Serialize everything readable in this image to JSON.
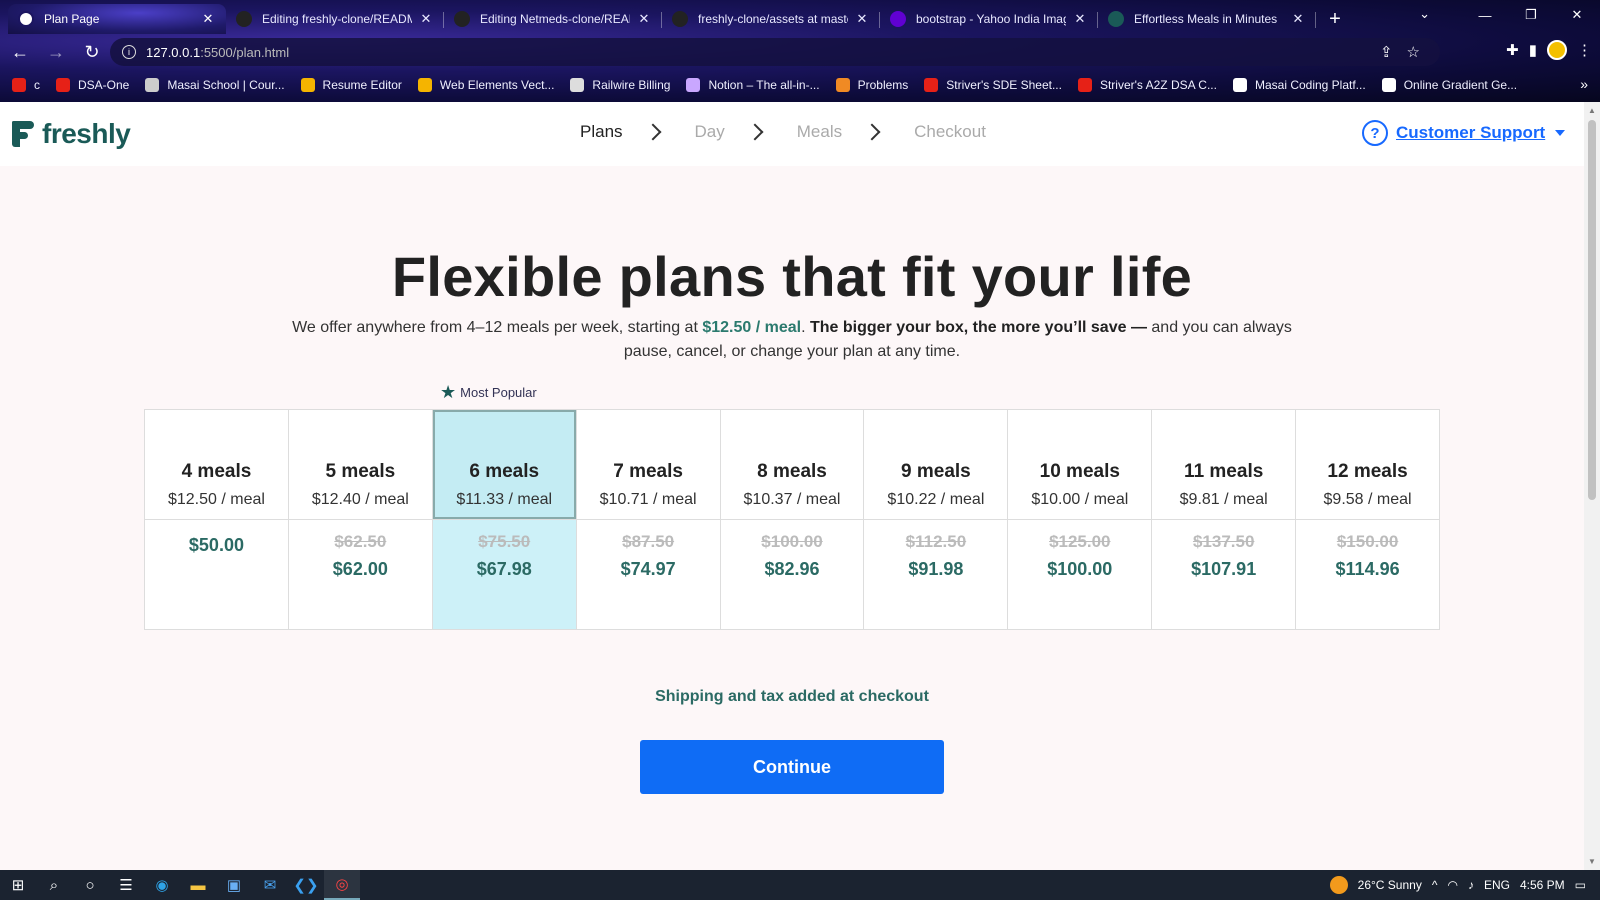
{
  "browser": {
    "tabs": [
      {
        "title": "Plan Page",
        "active": true,
        "favicon": "globe-icon"
      },
      {
        "title": "Editing freshly-clone/READM",
        "active": false,
        "favicon": "github-icon"
      },
      {
        "title": "Editing Netmeds-clone/READ",
        "active": false,
        "favicon": "github-icon"
      },
      {
        "title": "freshly-clone/assets at maste",
        "active": false,
        "favicon": "github-icon"
      },
      {
        "title": "bootstrap - Yahoo India Imag",
        "active": false,
        "favicon": "yahoo-icon"
      },
      {
        "title": "Effortless Meals in Minutes",
        "active": false,
        "favicon": "freshly-icon"
      }
    ],
    "url_host": "127.0.0.1",
    "url_path": ":5500/plan.html",
    "bookmarks": [
      {
        "label": "c",
        "icon": "youtube-icon",
        "color": "#e62117"
      },
      {
        "label": "DSA-One",
        "icon": "youtube-icon",
        "color": "#e62117"
      },
      {
        "label": "Masai School | Cour...",
        "icon": "masai-icon",
        "color": "#ccc"
      },
      {
        "label": "Resume Editor",
        "icon": "resume-icon",
        "color": "#f5b400"
      },
      {
        "label": "Web Elements Vect...",
        "icon": "web-elements-icon",
        "color": "#f5b400"
      },
      {
        "label": "Railwire Billing",
        "icon": "railwire-icon",
        "color": "#ddd"
      },
      {
        "label": "Notion – The all-in-...",
        "icon": "notion-icon",
        "color": "#c9a7ff"
      },
      {
        "label": "Problems",
        "icon": "problems-icon",
        "color": "#f08a24"
      },
      {
        "label": "Striver's SDE Sheet...",
        "icon": "tuf-icon",
        "color": "#e62117"
      },
      {
        "label": "Striver's A2Z DSA C...",
        "icon": "tuf-icon",
        "color": "#e62117"
      },
      {
        "label": "Masai Coding Platf...",
        "icon": "masai-coding-icon",
        "color": "#fff"
      },
      {
        "label": "Online Gradient Ge...",
        "icon": "gradient-icon",
        "color": "#fff"
      }
    ]
  },
  "header": {
    "logo_text": "freshly",
    "steps": [
      "Plans",
      "Day",
      "Meals",
      "Checkout"
    ],
    "current_step": 0,
    "support_label": "Customer Support"
  },
  "hero": {
    "title": "Flexible plans that fit your life",
    "sub_part1": "We offer anywhere from 4–12 meals per week, starting at ",
    "sub_price": "$12.50 / meal",
    "sub_part2": ". ",
    "sub_bold": "The bigger your box, the more you’ll save —",
    "sub_part3": " and you can always pause, cancel, or change your plan at any time."
  },
  "popular_label": "Most Popular",
  "plans": [
    {
      "meals": "4 meals",
      "per_meal": "$12.50 / meal",
      "old_price": "",
      "price": "$50.00",
      "selected": false
    },
    {
      "meals": "5 meals",
      "per_meal": "$12.40 / meal",
      "old_price": "$62.50",
      "price": "$62.00",
      "selected": false
    },
    {
      "meals": "6 meals",
      "per_meal": "$11.33 / meal",
      "old_price": "$75.50",
      "price": "$67.98",
      "selected": true
    },
    {
      "meals": "7 meals",
      "per_meal": "$10.71 / meal",
      "old_price": "$87.50",
      "price": "$74.97",
      "selected": false
    },
    {
      "meals": "8 meals",
      "per_meal": "$10.37 / meal",
      "old_price": "$100.00",
      "price": "$82.96",
      "selected": false
    },
    {
      "meals": "9 meals",
      "per_meal": "$10.22 / meal",
      "old_price": "$112.50",
      "price": "$91.98",
      "selected": false
    },
    {
      "meals": "10 meals",
      "per_meal": "$10.00 / meal",
      "old_price": "$125.00",
      "price": "$100.00",
      "selected": false
    },
    {
      "meals": "11 meals",
      "per_meal": "$9.81 / meal",
      "old_price": "$137.50",
      "price": "$107.91",
      "selected": false
    },
    {
      "meals": "12 meals",
      "per_meal": "$9.58 / meal",
      "old_price": "$150.00",
      "price": "$114.96",
      "selected": false
    }
  ],
  "shipping_note": "Shipping and tax added at checkout",
  "continue_label": "Continue",
  "taskbar": {
    "weather": "26°C  Sunny",
    "lang": "ENG",
    "time": "4:56 PM"
  },
  "colors": {
    "accent_blue": "#0f6cf5",
    "brand_green": "#1a5a57",
    "selected_bg": "#cdf1f8"
  }
}
